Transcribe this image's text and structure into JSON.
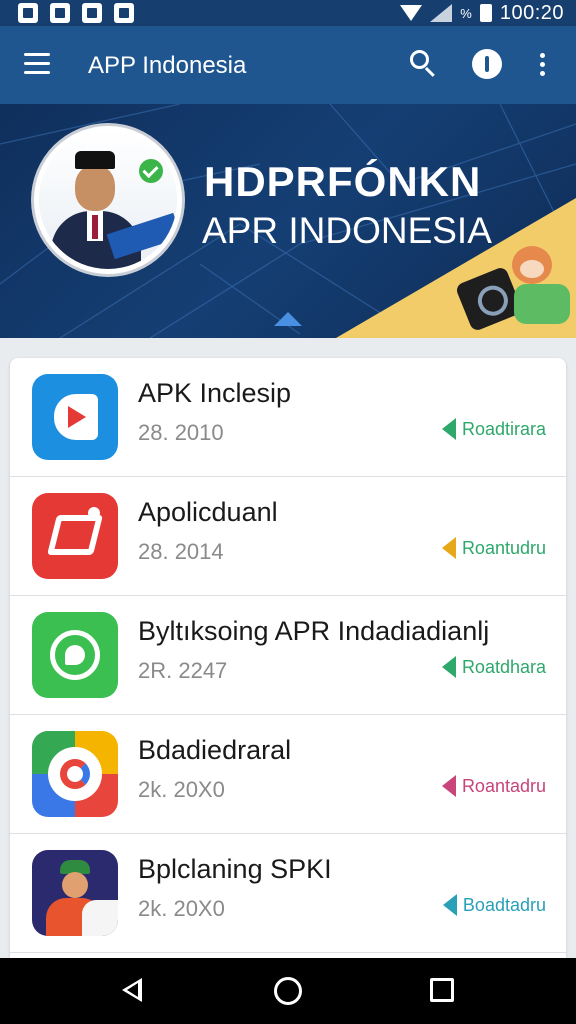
{
  "status_bar": {
    "battery_percent_label": "%",
    "time": "100:20",
    "icons": [
      "sim-icon",
      "notification-icon",
      "news-icon",
      "app-icon",
      "wifi-icon",
      "signal-icon",
      "battery-icon"
    ]
  },
  "app_bar": {
    "title": "APP Indonesia",
    "icons": [
      "menu-icon",
      "search-icon",
      "info-icon",
      "more-vert-icon"
    ]
  },
  "banner": {
    "headline": "HDPRFÓNKN",
    "subheadline": "APR INDONESIA",
    "accent_color": "#f3cc6a"
  },
  "apps": [
    {
      "name": "APK Inclesip",
      "meta": "28. 2010",
      "action_label": "Roadtirara",
      "action_color": "#2ea86b",
      "icon": "video-play-icon"
    },
    {
      "name": "Apolicduanl",
      "meta": "28. 2014",
      "action_label": "Roantudru",
      "action_color": "#e6a817",
      "icon": "red-app-icon"
    },
    {
      "name": "Byltıksoing APR Indadiadianlj",
      "meta": "2R. 2247",
      "action_label": "Roatdhara",
      "action_color": "#2ea86b",
      "icon": "chat-phone-icon"
    },
    {
      "name": "Bdadiedraral",
      "meta": "2k. 20X0",
      "action_label": "Roantadru",
      "action_color": "#c8447a",
      "icon": "colorful-ring-icon"
    },
    {
      "name": "Bplclaning SPKI",
      "meta": "2k. 20X0",
      "action_label": "Boadtadru",
      "action_color": "#2a9fb8",
      "icon": "character-icon"
    }
  ],
  "nav_bar": {
    "icons": [
      "back-icon",
      "home-icon",
      "recents-icon"
    ]
  }
}
